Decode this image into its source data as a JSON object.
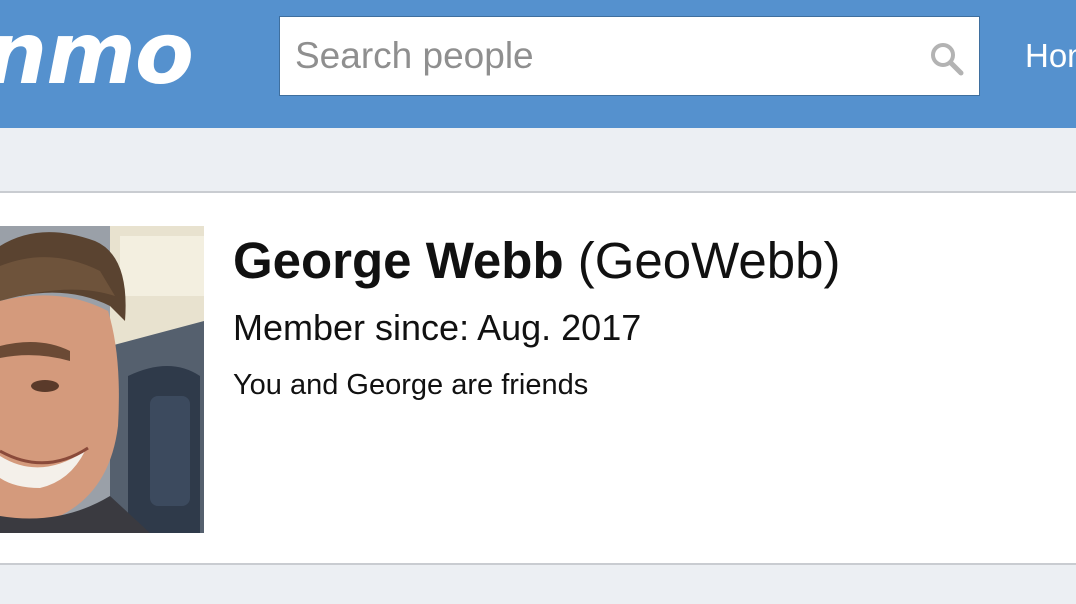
{
  "header": {
    "logo_text": "nmo",
    "search": {
      "placeholder": "Search people",
      "value": ""
    },
    "nav_home_label": "Home"
  },
  "profile": {
    "display_name": "George Webb",
    "username": "(GeoWebb)",
    "member_since": "Member since: Aug. 2017",
    "friend_status": "You and George are friends"
  },
  "colors": {
    "header_bg": "#5591ce",
    "page_bg": "#eceff3",
    "card_bg": "#ffffff"
  },
  "icons": {
    "search": "search-icon"
  }
}
